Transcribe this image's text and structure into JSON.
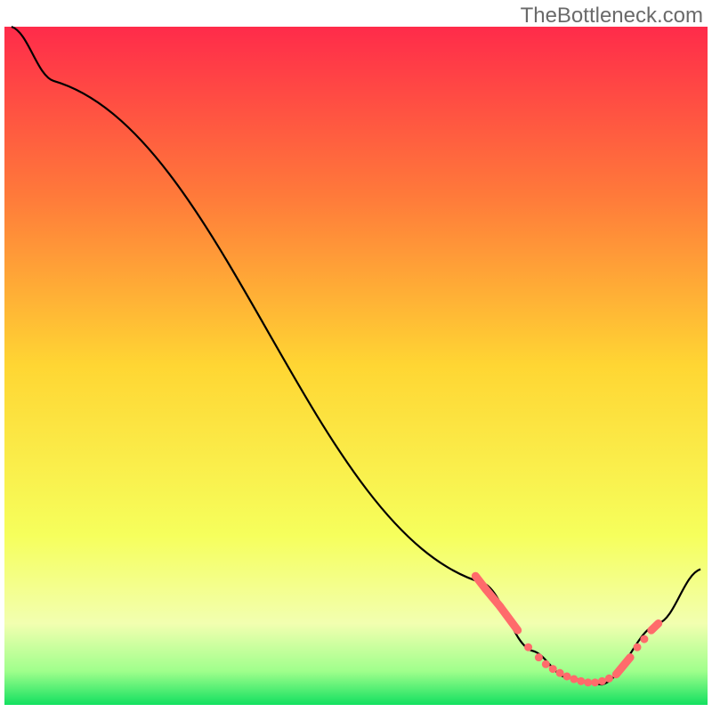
{
  "watermark": "TheBottleneck.com",
  "chart_data": {
    "type": "line",
    "title": "",
    "xlabel": "",
    "ylabel": "",
    "xlim": [
      0,
      100
    ],
    "ylim": [
      0,
      100
    ],
    "background_gradient_stops": [
      {
        "offset": 0,
        "color": "#ff2b4a"
      },
      {
        "offset": 25,
        "color": "#ff7a3a"
      },
      {
        "offset": 50,
        "color": "#ffd633"
      },
      {
        "offset": 75,
        "color": "#f6ff5c"
      },
      {
        "offset": 88,
        "color": "#f2ffb0"
      },
      {
        "offset": 95,
        "color": "#a0ff8c"
      },
      {
        "offset": 100,
        "color": "#13e060"
      }
    ],
    "series": [
      {
        "name": "curve",
        "stroke": "#000000",
        "points": [
          {
            "x": 1,
            "y": 100
          },
          {
            "x": 7,
            "y": 92
          },
          {
            "x": 68,
            "y": 18
          },
          {
            "x": 75,
            "y": 8
          },
          {
            "x": 80,
            "y": 4
          },
          {
            "x": 85,
            "y": 3
          },
          {
            "x": 93,
            "y": 12
          },
          {
            "x": 99,
            "y": 20
          }
        ]
      }
    ],
    "marker_dashes": {
      "stroke": "#ff6b6b",
      "segments": [
        {
          "x1": 67,
          "y1": 19,
          "x2": 68.5,
          "y2": 17
        },
        {
          "x1": 68.5,
          "y1": 17,
          "x2": 70.5,
          "y2": 14.5
        },
        {
          "x1": 70.5,
          "y1": 14.5,
          "x2": 73,
          "y2": 11
        },
        {
          "x1": 87,
          "y1": 4.5,
          "x2": 89,
          "y2": 7
        },
        {
          "x1": 92,
          "y1": 11,
          "x2": 93,
          "y2": 12
        }
      ]
    },
    "marker_dots": {
      "fill": "#ff6b6b",
      "points": [
        {
          "x": 74.5,
          "y": 8.5
        },
        {
          "x": 76,
          "y": 7
        },
        {
          "x": 77,
          "y": 6
        },
        {
          "x": 78,
          "y": 5.3
        },
        {
          "x": 79,
          "y": 4.7
        },
        {
          "x": 80,
          "y": 4.2
        },
        {
          "x": 81,
          "y": 3.8
        },
        {
          "x": 82,
          "y": 3.5
        },
        {
          "x": 83,
          "y": 3.3
        },
        {
          "x": 84,
          "y": 3.3
        },
        {
          "x": 85,
          "y": 3.5
        },
        {
          "x": 86,
          "y": 3.9
        },
        {
          "x": 90,
          "y": 8.5
        },
        {
          "x": 91,
          "y": 9.7
        }
      ]
    }
  }
}
